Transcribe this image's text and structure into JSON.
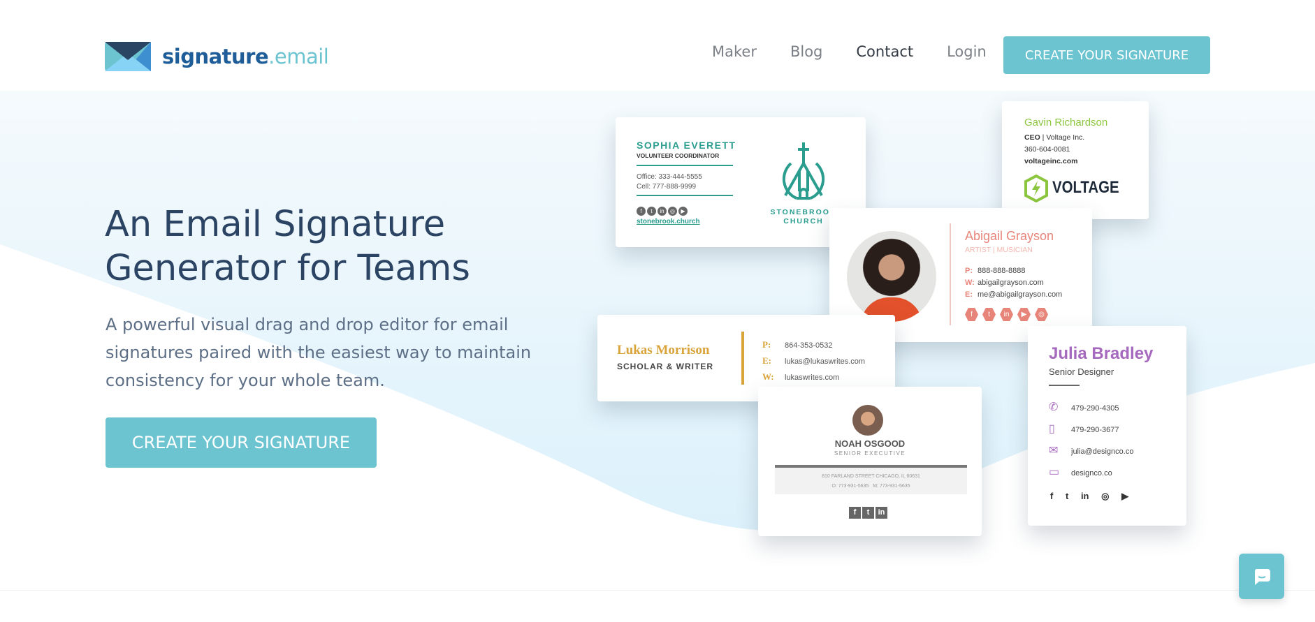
{
  "brand": {
    "name_main": "signature",
    "name_tld": ".email"
  },
  "nav": {
    "items": [
      {
        "label": "Maker"
      },
      {
        "label": "Blog"
      },
      {
        "label": "Contact"
      },
      {
        "label": "Login"
      }
    ],
    "cta": "CREATE YOUR SIGNATURE"
  },
  "hero": {
    "title": "An Email Signature Generator for Teams",
    "lead": "A powerful visual drag and drop editor for email signatures paired with the easiest way to maintain consistency for your whole team.",
    "cta": "CREATE YOUR SIGNATURE"
  },
  "colors": {
    "accent": "#6cc4d1",
    "brand": "#1f5d99",
    "heading": "#2c4463"
  },
  "cards": {
    "sophia": {
      "name": "SOPHIA EVERETT",
      "title": "VOLUNTEER COORDINATOR",
      "office": "Office: 333-444-5555",
      "cell": "Cell: 777-888-9999",
      "link": "stonebrook.church",
      "logo_text1": "STONEBROOK",
      "logo_text2": "CHURCH"
    },
    "gavin": {
      "name": "Gavin Richardson",
      "role": "CEO",
      "company": "Voltage Inc.",
      "phone": "360-604-0081",
      "web": "voltageinc.com",
      "logo_text": "VOLTAGE"
    },
    "abigail": {
      "name": "Abigail Grayson",
      "title": "ARTIST | MUSICIAN",
      "p_label": "P:",
      "phone": "888-888-8888",
      "w_label": "W:",
      "web": "abigailgrayson.com",
      "e_label": "E:",
      "email": "me@abigailgrayson.com"
    },
    "lukas": {
      "name": "Lukas Morrison",
      "title": "SCHOLAR & WRITER",
      "p_label": "P:",
      "phone": "864-353-0532",
      "e_label": "E:",
      "email": "lukas@lukaswrites.com",
      "w_label": "W:",
      "web": "lukaswrites.com"
    },
    "noah": {
      "name": "NOAH OSGOOD",
      "title": "SENIOR EXECUTIVE",
      "address": "810 FARLAND STREET CHICAGO, IL 60631",
      "office": "O: 773-931-5635",
      "mobile": "M: 773-931-5635"
    },
    "julia": {
      "name": "Julia Bradley",
      "title": "Senior Designer",
      "phone": "479-290-4305",
      "mobile": "479-290-3677",
      "email": "julia@designco.co",
      "web": "designco.co"
    }
  }
}
